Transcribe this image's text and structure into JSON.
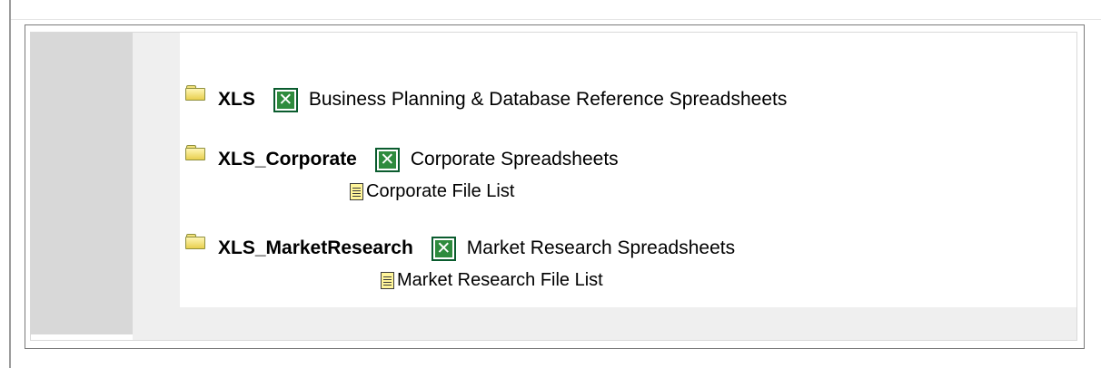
{
  "folders": [
    {
      "name": "XLS",
      "icon": "folder-icon",
      "spreadsheet_icon": "excel-icon",
      "description": "Business Planning & Database Reference Spreadsheets"
    },
    {
      "name": "XLS_Corporate",
      "icon": "folder-icon",
      "spreadsheet_icon": "excel-icon",
      "description": "Corporate Spreadsheets",
      "file_list": {
        "icon": "text-document-icon",
        "label": "Corporate File List"
      }
    },
    {
      "name": "XLS_MarketResearch",
      "icon": "folder-icon",
      "spreadsheet_icon": "excel-icon",
      "description": "Market Research Spreadsheets",
      "file_list": {
        "icon": "text-document-icon",
        "label": "Market Research File List"
      }
    }
  ],
  "colors": {
    "folder": "#f3e27a",
    "excel_green": "#2e8b3d",
    "document_yellow": "#fff59a",
    "side_column": "#d8d8d8",
    "footer_band": "#efefef"
  }
}
